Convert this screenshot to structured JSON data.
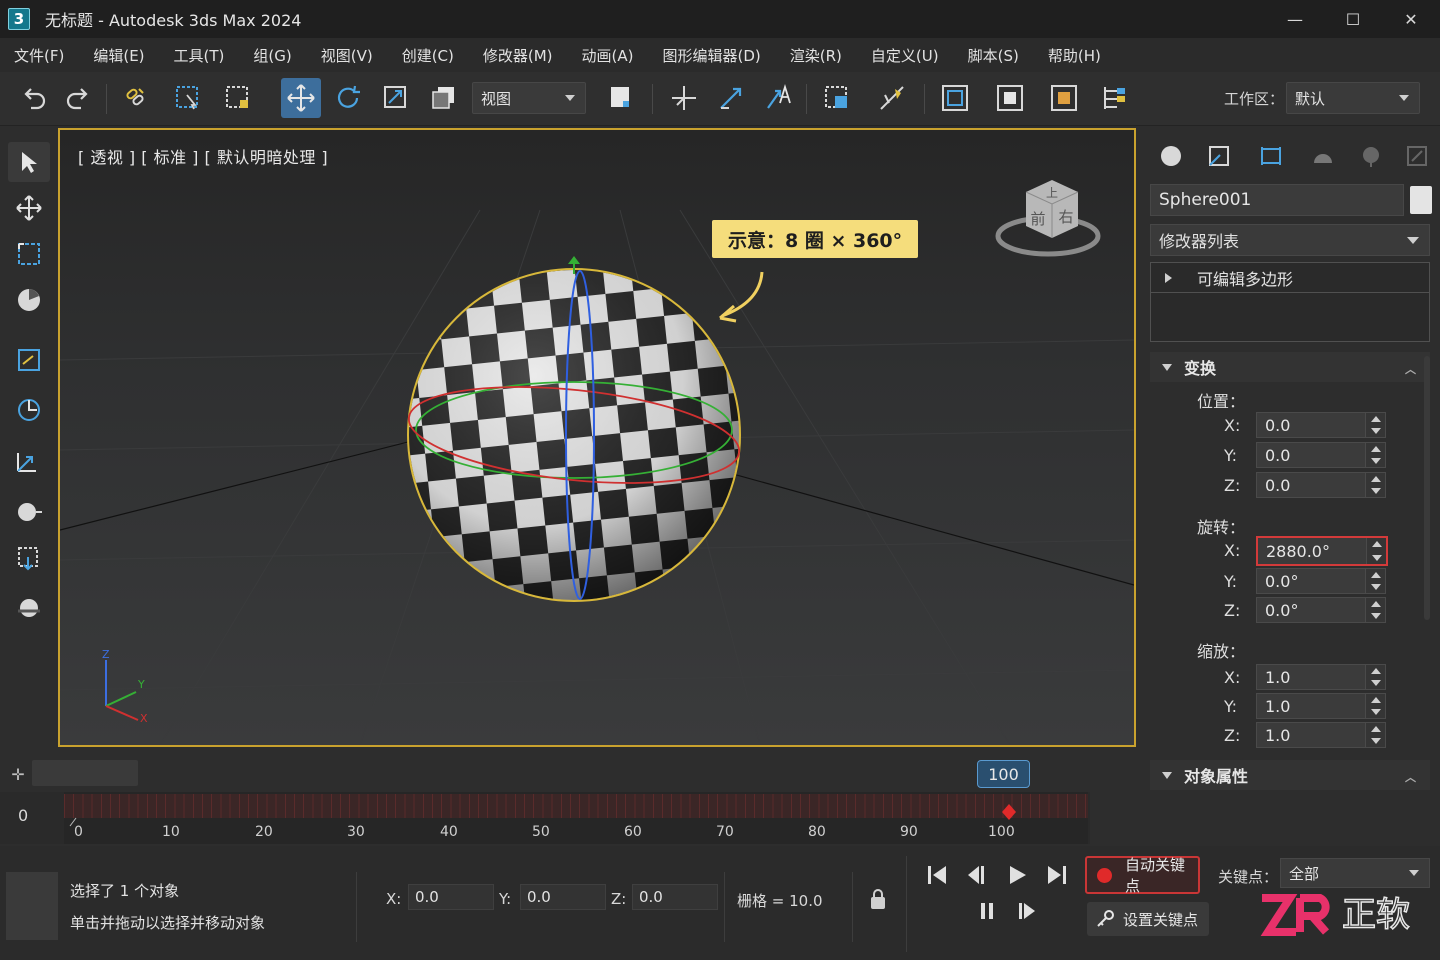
{
  "window": {
    "app_number": "3",
    "title": "无标题 - Autodesk 3ds Max 2024",
    "minimize": "—",
    "maximize": "☐",
    "close": "✕"
  },
  "menu": [
    "文件(F)",
    "编辑(E)",
    "工具(T)",
    "组(G)",
    "视图(V)",
    "创建(C)",
    "修改器(M)",
    "动画(A)",
    "图形编辑器(D)",
    "渲染(R)",
    "自定义(U)",
    "脚本(S)",
    "帮助(H)"
  ],
  "toolbar": {
    "reference_coord": "视图",
    "workspace_label": "工作区：",
    "workspace_value": "默认",
    "icons": [
      "undo-icon",
      "redo-icon",
      "select-link-icon",
      "select-region-icon",
      "window-crossing-icon",
      "select-move-icon",
      "rotate-icon",
      "scale-icon",
      "place-icon",
      "reference-coord-dropdown",
      "pivot-icon",
      "snaps-icon",
      "angle-snap-icon",
      "percent-snap-icon",
      "named-selection-icon",
      "mirror-icon",
      "scene-explorer-icon",
      "layer-icon",
      "render-setup-icon",
      "render-frame-icon",
      "schematic-icon"
    ]
  },
  "viewport": {
    "label": "[ 透视 ] [ 标准 ] [ 默认明暗处理 ]",
    "callout": "示意：8 圈 × 360°",
    "viewcube": {
      "top": "上",
      "front": "前",
      "right": "右"
    },
    "axis": {
      "x": "X",
      "y": "Y",
      "z": "Z"
    }
  },
  "command_panel": {
    "object_name": "Sphere001",
    "modifier_list": "修改器列表",
    "stack_item": "可编辑多边形",
    "transform_title": "变换",
    "position_label": "位置：",
    "position": {
      "x": "0.0",
      "y": "0.0",
      "z": "0.0"
    },
    "rotation_label": "旋转：",
    "rotation": {
      "x": "2880.0°",
      "y": "0.0°",
      "z": "0.0°"
    },
    "scale_label": "缩放：",
    "scale": {
      "x": "1.0",
      "y": "1.0",
      "z": "1.0"
    },
    "axis_x": "X:",
    "axis_y": "Y:",
    "axis_z": "Z:",
    "object_props_title": "对象属性"
  },
  "timeline": {
    "start": "0",
    "current_frame": "100",
    "ticks": [
      "0",
      "10",
      "20",
      "30",
      "40",
      "50",
      "60",
      "70",
      "80",
      "90",
      "100"
    ]
  },
  "status": {
    "line1": "选择了 1 个对象",
    "line2": "单击并拖动以选择并移动对象",
    "x_label": "X:",
    "x_value": "0.0",
    "y_label": "Y:",
    "y_value": "0.0",
    "z_label": "Z:",
    "z_value": "0.0",
    "grid": "栅格 = 10.0",
    "auto_key": "自动关键点",
    "set_key": "设置关键点",
    "keypoint_label": "关键点：",
    "keypoint_value": "全部"
  },
  "colors": {
    "accent": "#3d6e9c",
    "highlight": "#d33a3a",
    "selection": "#c9a22e",
    "callout": "#f5dd7c"
  }
}
